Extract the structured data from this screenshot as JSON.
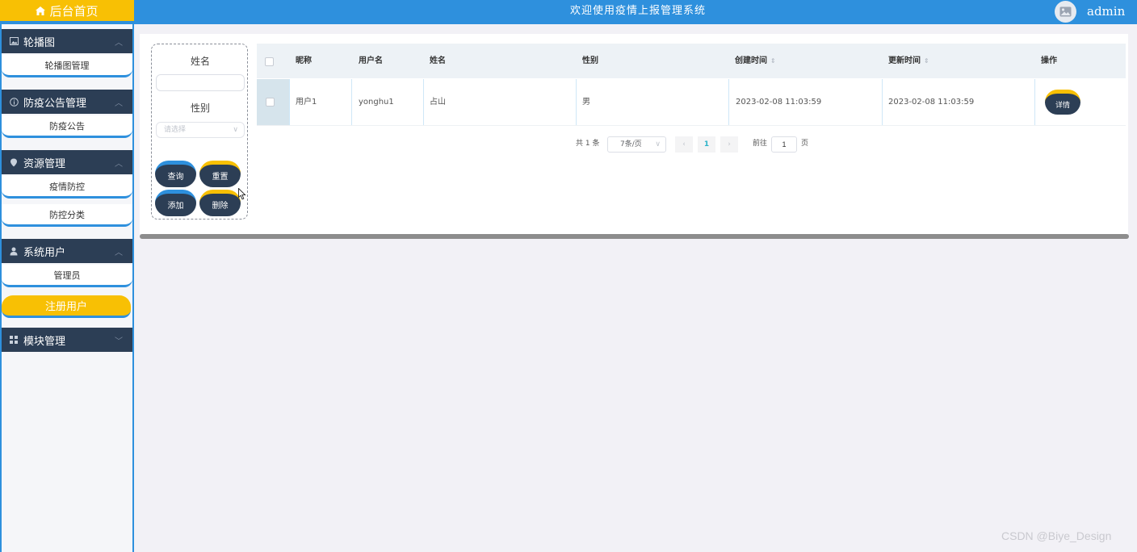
{
  "header": {
    "home_label": "后台首页",
    "title": "欢迎使用疫情上报管理系统",
    "username": "admin",
    "home_icon": "home-icon",
    "avatar_icon": "image-icon"
  },
  "sidebar": {
    "groups": [
      {
        "label": "轮播图",
        "icon": "picture-icon",
        "items": [
          {
            "label": "轮播图管理"
          }
        ]
      },
      {
        "label": "防疫公告管理",
        "icon": "info-icon",
        "items": [
          {
            "label": "防疫公告"
          }
        ]
      },
      {
        "label": "资源管理",
        "icon": "location-icon",
        "items": [
          {
            "label": "疫情防控"
          },
          {
            "label": "防控分类"
          }
        ]
      },
      {
        "label": "系统用户",
        "icon": "user-icon",
        "items": [
          {
            "label": "管理员"
          }
        ]
      },
      {
        "label": "模块管理",
        "icon": "grid-icon",
        "items": []
      }
    ],
    "register_label": "注册用户"
  },
  "search": {
    "name_label": "姓名",
    "name_value": "",
    "gender_label": "性别",
    "gender_placeholder": "请选择",
    "query_label": "查询",
    "reset_label": "重置",
    "add_label": "添加",
    "delete_label": "删除"
  },
  "table": {
    "columns": [
      "昵称",
      "用户名",
      "姓名",
      "性别",
      "创建时间",
      "更新时间",
      "操作"
    ],
    "rows": [
      {
        "nickname": "用户1",
        "username": "yonghu1",
        "name": "占山",
        "gender": "男",
        "created": "2023-02-08 11:03:59",
        "updated": "2023-02-08 11:03:59",
        "action": "详情"
      }
    ]
  },
  "pagination": {
    "total_text": "共 1 条",
    "page_size": "7条/页",
    "current_page": "1",
    "goto_label": "前往",
    "goto_value": "1",
    "page_suffix": "页"
  },
  "watermark": "CSDN @Biye_Design",
  "colors": {
    "primary_blue": "#2e90dd",
    "accent_yellow": "#f8c004",
    "dark_navy": "#2c3e55",
    "background": "#f2f1f6"
  }
}
